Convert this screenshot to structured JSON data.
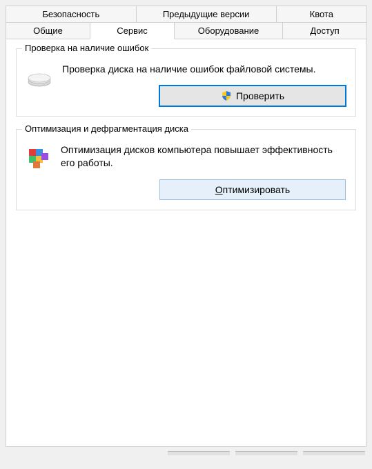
{
  "tabs_row1": [
    {
      "label": "Безопасность"
    },
    {
      "label": "Предыдущие версии"
    },
    {
      "label": "Квота"
    }
  ],
  "tabs_row2": [
    {
      "label": "Общие"
    },
    {
      "label": "Сервис",
      "active": true
    },
    {
      "label": "Оборудование"
    },
    {
      "label": "Доступ"
    }
  ],
  "check": {
    "title": "Проверка на наличие ошибок",
    "desc": "Проверка диска на наличие ошибок файловой системы.",
    "button": "Проверить"
  },
  "optimize": {
    "title": "Оптимизация и дефрагментация диска",
    "desc": "Оптимизация дисков компьютера повышает эффективность его работы.",
    "button": "Оптимизировать"
  }
}
